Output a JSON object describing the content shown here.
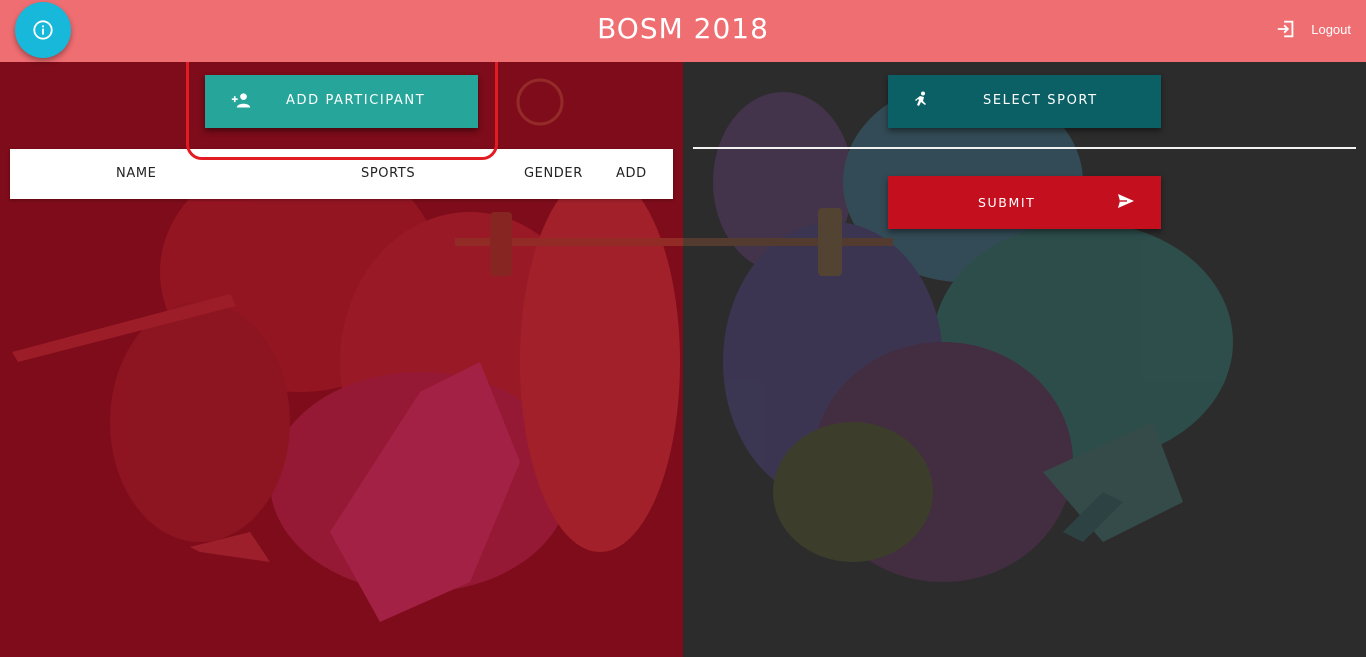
{
  "header": {
    "title": "BOSM 2018",
    "logout_label": "Logout"
  },
  "left": {
    "add_participant_label": "ADD PARTICIPANT",
    "table_columns": [
      "NAME",
      "SPORTS",
      "GENDER",
      "ADD"
    ]
  },
  "right": {
    "select_sport_label": "SELECT SPORT",
    "submit_label": "SUBMIT"
  },
  "colors": {
    "header": "#ef6e72",
    "info_fab": "#17b8d9",
    "left_panel": "#7e0c1a",
    "right_panel": "#2c2c2c",
    "add_button": "#26a69a",
    "select_sport_button": "#0b6066",
    "submit_button": "#c4101e",
    "highlight": "#e31b23"
  },
  "icons": {
    "info": "info-icon",
    "logout": "logout-icon",
    "add_person": "person-add-icon",
    "sport": "running-person-icon",
    "send": "send-icon"
  }
}
